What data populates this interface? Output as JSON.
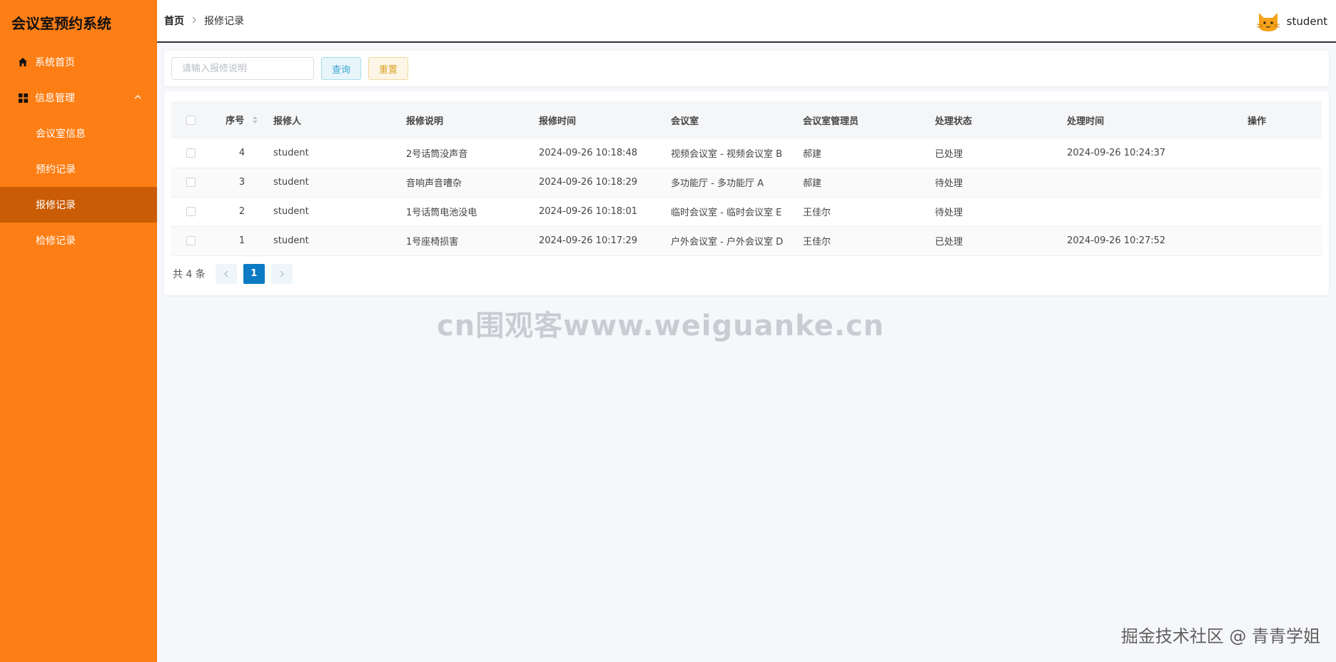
{
  "app": {
    "title": "会议室预约系统"
  },
  "sidebar": {
    "items": [
      {
        "label": "系统首页",
        "icon": "home-icon"
      },
      {
        "label": "信息管理",
        "icon": "grid-icon",
        "expanded": true
      }
    ],
    "submenu": [
      {
        "label": "会议室信息",
        "active": false
      },
      {
        "label": "预约记录",
        "active": false
      },
      {
        "label": "报修记录",
        "active": true
      },
      {
        "label": "检修记录",
        "active": false
      }
    ],
    "colors": {
      "background": "#fd7e14",
      "active": "#c95c04"
    }
  },
  "header": {
    "breadcrumb": {
      "home": "首页",
      "current": "报修记录"
    },
    "user": {
      "name": "student",
      "avatar_icon": "cat-avatar-icon"
    }
  },
  "search": {
    "placeholder": "请输入报修说明",
    "value": "",
    "query_label": "查询",
    "reset_label": "重置"
  },
  "table": {
    "headers": {
      "index": "序号",
      "reporter": "报修人",
      "description": "报修说明",
      "time": "报修时间",
      "room": "会议室",
      "manager": "会议室管理员",
      "status": "处理状态",
      "handled_time": "处理时间",
      "actions": "操作"
    },
    "rows": [
      {
        "index": "4",
        "reporter": "student",
        "description": "2号话筒没声音",
        "time": "2024-09-26 10:18:48",
        "room": "视频会议室 - 视频会议室 B",
        "manager": "郝建",
        "status": "已处理",
        "handled_time": "2024-09-26 10:24:37"
      },
      {
        "index": "3",
        "reporter": "student",
        "description": "音响声音嘈杂",
        "time": "2024-09-26 10:18:29",
        "room": "多功能厅 - 多功能厅 A",
        "manager": "郝建",
        "status": "待处理",
        "handled_time": ""
      },
      {
        "index": "2",
        "reporter": "student",
        "description": "1号话筒电池没电",
        "time": "2024-09-26 10:18:01",
        "room": "临时会议室 - 临时会议室 E",
        "manager": "王佳尔",
        "status": "待处理",
        "handled_time": ""
      },
      {
        "index": "1",
        "reporter": "student",
        "description": "1号座椅损害",
        "time": "2024-09-26 10:17:29",
        "room": "户外会议室 - 户外会议室 D",
        "manager": "王佳尔",
        "status": "已处理",
        "handled_time": "2024-09-26 10:27:52"
      }
    ]
  },
  "pagination": {
    "total_text": "共 4 条",
    "current_page": "1",
    "prev_icon": "chevron-left-icon",
    "next_icon": "chevron-right-icon"
  },
  "watermarks": {
    "center": "cn围观客www.weiguanke.cn",
    "corner": "掘金技术社区 @ 青青学姐"
  }
}
